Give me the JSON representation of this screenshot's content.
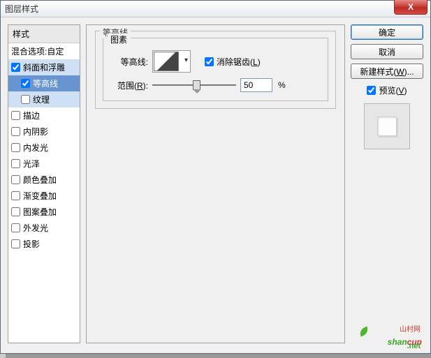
{
  "window": {
    "title": "图层样式",
    "close": "X"
  },
  "sidebar": {
    "header": "样式",
    "blend": "混合选项:自定",
    "items": [
      {
        "label": "斜面和浮雕",
        "checked": true,
        "indent": false,
        "sel": "selected-light"
      },
      {
        "label": "等高线",
        "checked": true,
        "indent": true,
        "sel": "selected"
      },
      {
        "label": "纹理",
        "checked": false,
        "indent": true,
        "sel": "selected-light"
      },
      {
        "label": "描边",
        "checked": false,
        "indent": false,
        "sel": ""
      },
      {
        "label": "内阴影",
        "checked": false,
        "indent": false,
        "sel": ""
      },
      {
        "label": "内发光",
        "checked": false,
        "indent": false,
        "sel": ""
      },
      {
        "label": "光泽",
        "checked": false,
        "indent": false,
        "sel": ""
      },
      {
        "label": "颜色叠加",
        "checked": false,
        "indent": false,
        "sel": ""
      },
      {
        "label": "渐变叠加",
        "checked": false,
        "indent": false,
        "sel": ""
      },
      {
        "label": "图案叠加",
        "checked": false,
        "indent": false,
        "sel": ""
      },
      {
        "label": "外发光",
        "checked": false,
        "indent": false,
        "sel": ""
      },
      {
        "label": "投影",
        "checked": false,
        "indent": false,
        "sel": ""
      }
    ]
  },
  "main": {
    "group_title": "等高线",
    "elements_title": "图素",
    "contour_label": "等高线:",
    "antialias_prefix": "消除锯齿(",
    "antialias_key": "L",
    "antialias_suffix": ")",
    "antialias_checked": true,
    "range_label_prefix": "范围(",
    "range_key": "R",
    "range_label_suffix": "):",
    "range_value": "50",
    "range_unit": "%"
  },
  "buttons": {
    "ok": "确定",
    "cancel": "取消",
    "newstyle_prefix": "新建样式(",
    "newstyle_key": "W",
    "newstyle_suffix": ")...",
    "preview_prefix": "预览(",
    "preview_key": "V",
    "preview_suffix": ")",
    "preview_checked": true
  },
  "watermark": {
    "text_g": "shan",
    "text_r": "cun",
    "sub": "山村网",
    "net": ".net"
  }
}
